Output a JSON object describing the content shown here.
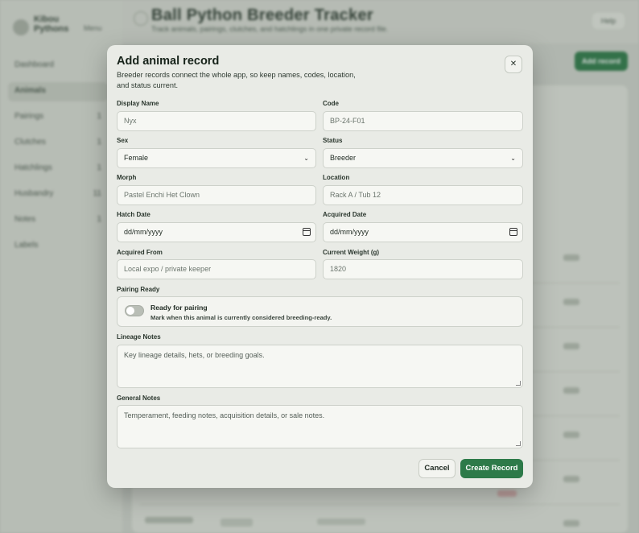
{
  "background": {
    "brand_name": "Kibou Pythons",
    "brand_menu_label": "Menu",
    "nav_items": [
      {
        "label": "Dashboard",
        "count": ""
      },
      {
        "label": "Animals",
        "count": ""
      },
      {
        "label": "Pairings",
        "count": "1"
      },
      {
        "label": "Clutches",
        "count": "1"
      },
      {
        "label": "Hatchlings",
        "count": "1"
      },
      {
        "label": "Husbandry",
        "count": "11"
      },
      {
        "label": "Notes",
        "count": "1"
      },
      {
        "label": "Labels",
        "count": ""
      }
    ],
    "app_title": "Ball Python Breeder Tracker",
    "app_subtitle": "Track animals, pairings, clutches, and hatchlings in one private record file.",
    "help_label": "Help",
    "add_record_label": "Add record"
  },
  "modal": {
    "title": "Add animal record",
    "description": "Breeder records connect the whole app, so keep names, codes, location, and status current.",
    "close_icon": "close-icon",
    "fields": {
      "display_name": {
        "label": "Display Name",
        "placeholder": "Nyx"
      },
      "code": {
        "label": "Code",
        "placeholder": "BP-24-F01"
      },
      "sex": {
        "label": "Sex",
        "value": "Female"
      },
      "status": {
        "label": "Status",
        "value": "Breeder"
      },
      "morph": {
        "label": "Morph",
        "placeholder": "Pastel Enchi Het Clown"
      },
      "location": {
        "label": "Location",
        "placeholder": "Rack A / Tub 12"
      },
      "hatch_date": {
        "label": "Hatch Date",
        "value": "dd/mm/yyyy"
      },
      "acquired_date": {
        "label": "Acquired Date",
        "value": "dd/mm/yyyy"
      },
      "acquired_from": {
        "label": "Acquired From",
        "placeholder": "Local expo / private keeper"
      },
      "current_weight": {
        "label": "Current Weight (g)",
        "placeholder": "1820"
      }
    },
    "pairing": {
      "label": "Pairing Ready",
      "title": "Ready for pairing",
      "subtitle": "Mark when this animal is currently considered breeding-ready.",
      "checked": false
    },
    "lineage_notes": {
      "label": "Lineage Notes",
      "placeholder": "Key lineage details, hets, or breeding goals."
    },
    "general_notes": {
      "label": "General Notes",
      "placeholder": "Temperament, feeding notes, acquisition details, or sale notes."
    },
    "buttons": {
      "cancel": "Cancel",
      "create": "Create Record"
    }
  }
}
